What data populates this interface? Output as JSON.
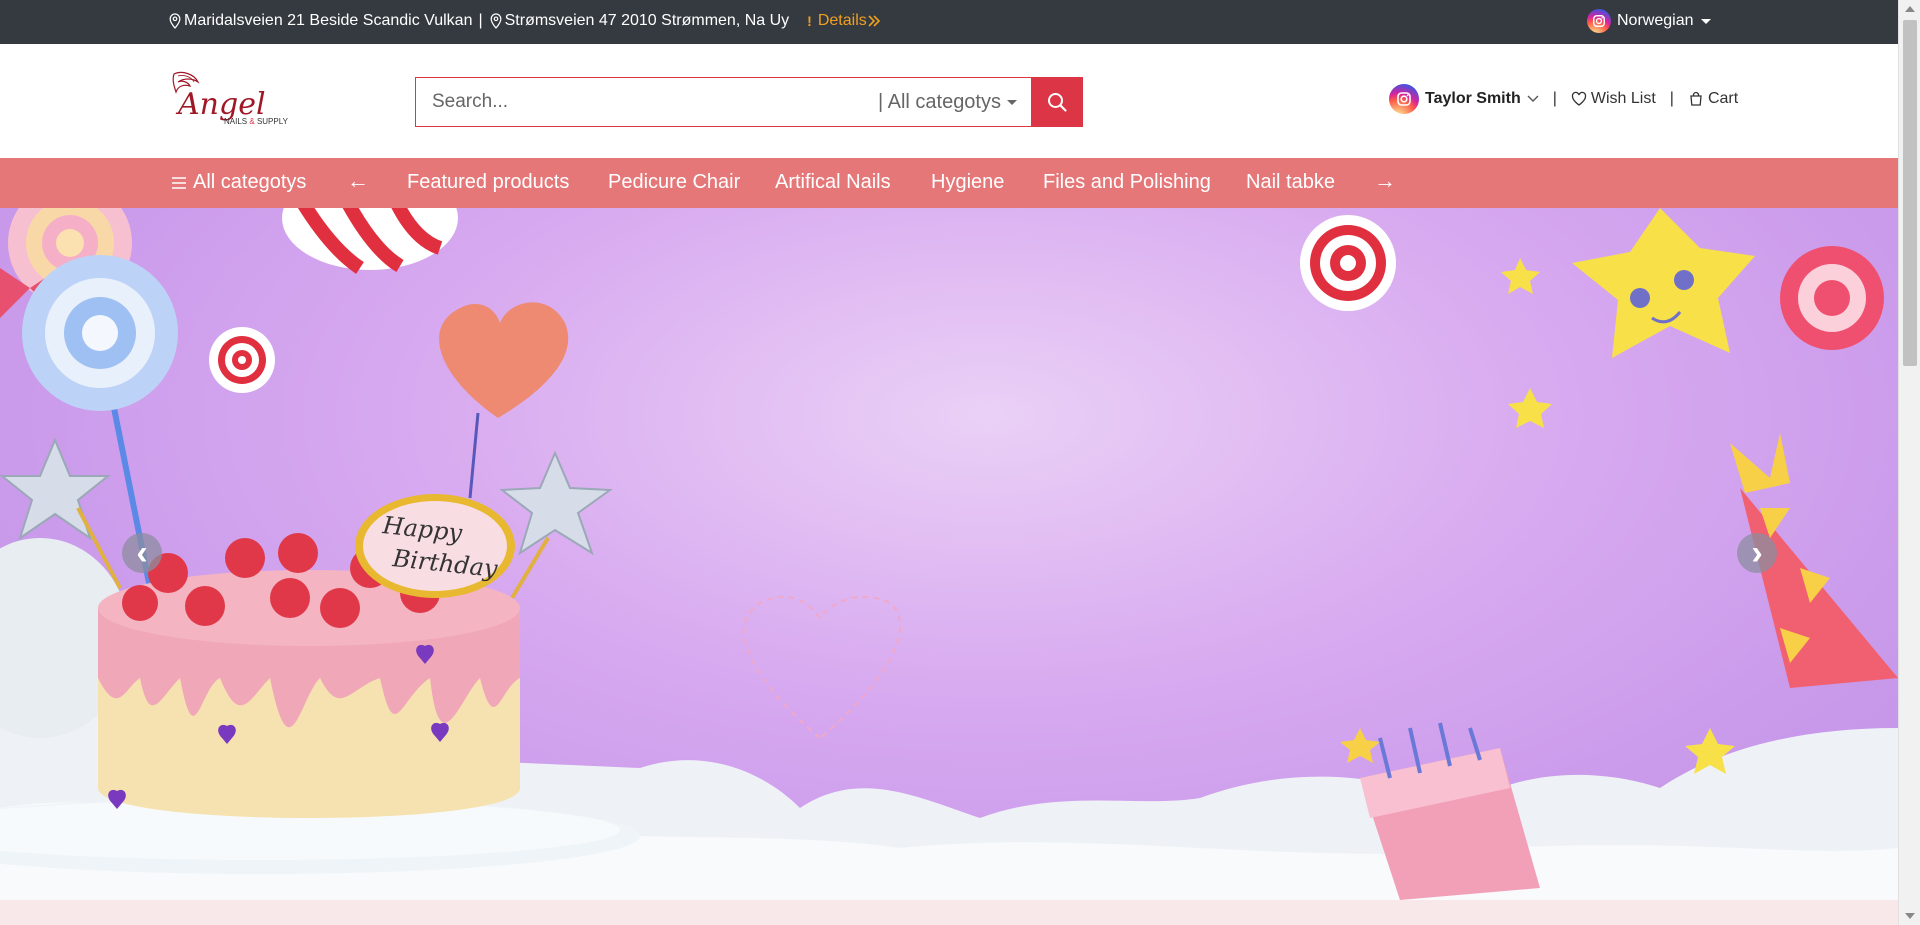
{
  "topbar": {
    "address_1": "Maridalsveien 21 Beside Scandic Vulkan",
    "separator": "|",
    "address_2": "Strømsveien 47 2010 Strømmen, Na Uy",
    "details_mark": "!",
    "details_label": "Details",
    "language": "Norwegian"
  },
  "header": {
    "logo_text": "Angel",
    "logo_subtext_1": "NAILS",
    "logo_subtext_amp": "&",
    "logo_subtext_2": "SUPPLY",
    "search_placeholder": "Search...",
    "category_select": "| All categotys",
    "user_name": "Taylor Smith",
    "pipe": "|",
    "wishlist_label": "Wish List",
    "cart_label": "Cart"
  },
  "nav": {
    "all_categories": "All categotys",
    "prev_arrow": "←",
    "items": [
      "Featured products",
      "Pedicure Chair",
      "Artifical Nails",
      "Hygiene",
      "Files and Polishing",
      "Nail tabke"
    ],
    "next_arrow": "→"
  },
  "banner": {
    "cake_text_1": "Happy",
    "cake_text_2": "Birthday",
    "prev_control": "‹",
    "next_control": "›"
  },
  "colors": {
    "topbar_bg": "#343a40",
    "details": "#f0a020",
    "brand_red": "#dc3545",
    "nav_bg": "#e57779",
    "banner_purple": "#d8aaf0"
  }
}
